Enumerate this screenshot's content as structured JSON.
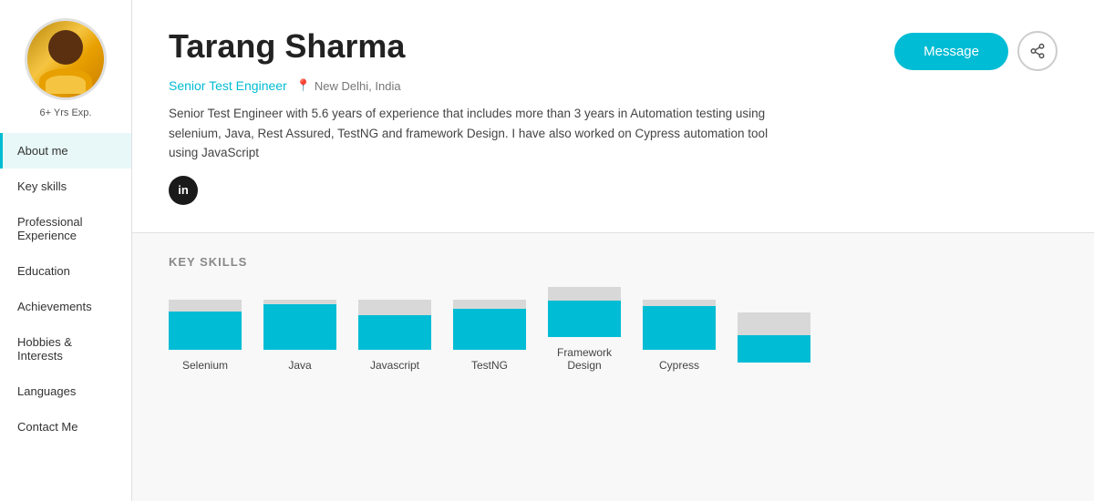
{
  "sidebar": {
    "exp_label": "6+ Yrs Exp.",
    "nav_items": [
      {
        "id": "about-me",
        "label": "About me",
        "active": true
      },
      {
        "id": "key-skills",
        "label": "Key skills",
        "active": false
      },
      {
        "id": "professional-experience",
        "label": "Professional Experience",
        "active": false
      },
      {
        "id": "education",
        "label": "Education",
        "active": false
      },
      {
        "id": "achievements",
        "label": "Achievements",
        "active": false
      },
      {
        "id": "hobbies",
        "label": "Hobbies & Interests",
        "active": false
      },
      {
        "id": "languages",
        "label": "Languages",
        "active": false
      },
      {
        "id": "contact-me",
        "label": "Contact Me",
        "active": false
      }
    ]
  },
  "profile": {
    "name": "Tarang Sharma",
    "job_title": "Senior Test Engineer",
    "location": "New Delhi, India",
    "bio": "Senior Test Engineer with 5.6 years of experience that includes more than 3 years in Automation testing using selenium, Java, Rest Assured, TestNG and framework Design. I have also worked on Cypress automation tool using JavaScript",
    "message_btn": "Message",
    "share_tooltip": "Share"
  },
  "skills": {
    "section_title": "KEY SKILLS",
    "items": [
      {
        "label": "Selenium",
        "fill_height": 42,
        "total_height": 55
      },
      {
        "label": "Java",
        "fill_height": 50,
        "total_height": 55
      },
      {
        "label": "Javascript",
        "fill_height": 38,
        "total_height": 55
      },
      {
        "label": "TestNG",
        "fill_height": 45,
        "total_height": 55
      },
      {
        "label": "Framework\nDesign",
        "fill_height": 40,
        "total_height": 55
      },
      {
        "label": "Cypress",
        "fill_height": 48,
        "total_height": 55
      }
    ],
    "partial_item": {
      "label": "",
      "fill_height": 30,
      "total_height": 55
    }
  },
  "colors": {
    "accent": "#00bcd4",
    "nav_active_border": "#00bcd4"
  }
}
